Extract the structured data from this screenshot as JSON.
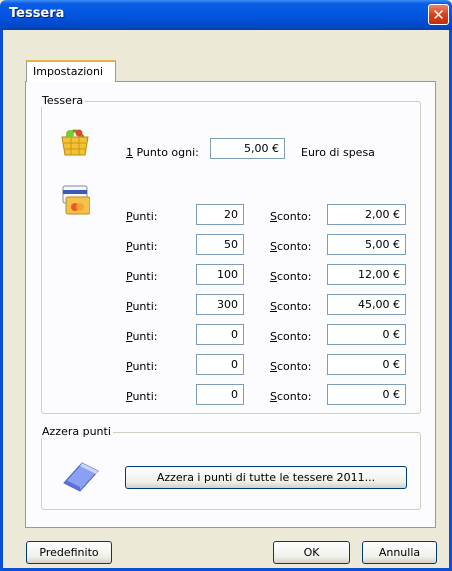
{
  "window": {
    "title": "Tessera"
  },
  "tabs": [
    {
      "label": "Impostazioni"
    }
  ],
  "tessera": {
    "legend": "Tessera",
    "punto_ogni_prefix": "1",
    "punto_ogni_label": " Punto ogni:",
    "punto_ogni_value": "5,00 €",
    "euro_di_spesa": "Euro di spesa",
    "punti_label": "Punti:",
    "sconto_label": "Sconto:",
    "rows": [
      {
        "punti": "20",
        "sconto": "2,00 €"
      },
      {
        "punti": "50",
        "sconto": "5,00 €"
      },
      {
        "punti": "100",
        "sconto": "12,00 €"
      },
      {
        "punti": "300",
        "sconto": "45,00 €"
      },
      {
        "punti": "0",
        "sconto": "0 €"
      },
      {
        "punti": "0",
        "sconto": "0 €"
      },
      {
        "punti": "0",
        "sconto": "0 €"
      }
    ]
  },
  "azzera": {
    "legend": "Azzera punti",
    "button": "Azzera i punti di tutte le tessere 2011..."
  },
  "footer": {
    "predefinito": "Predefinito",
    "ok": "OK",
    "annulla": "Annulla"
  },
  "icons": {
    "close": "close-icon",
    "basket": "basket-icon",
    "card": "card-icon",
    "eraser": "eraser-icon"
  }
}
